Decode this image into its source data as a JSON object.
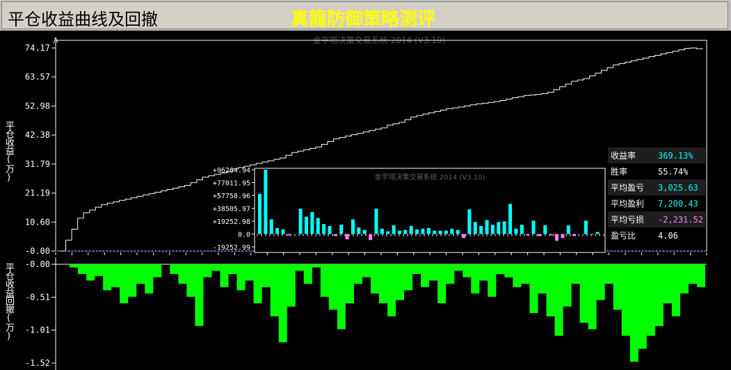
{
  "title_left": "平仓收益曲线及回撤",
  "title_center": "真龍防御策略测评",
  "watermark_main": "金字塔决策交易系统 2014 (V3.10)",
  "watermark_inset": "金字塔决策交易系统 2014 (V3.10)",
  "colors": {
    "bg": "#000000",
    "equity_line": "#ffffff",
    "drawdown_fill": "#00ff00",
    "bar_pos": "#00ffff",
    "bar_neg": "#ff80ff",
    "zero_line": "#4040ff",
    "title_text": "#ffff00"
  },
  "stats": [
    {
      "label": "收益率",
      "value": "369.13%",
      "color": "#00ffff",
      "shaded": true
    },
    {
      "label": "胜率",
      "value": "55.74%",
      "color": "#ffffff",
      "shaded": false
    },
    {
      "label": "平均盈亏",
      "value": "3,025.63",
      "color": "#00ffff",
      "shaded": true
    },
    {
      "label": "平均盈利",
      "value": "7,200.43",
      "color": "#00ffff",
      "shaded": false
    },
    {
      "label": "平均亏损",
      "value": "-2,231.52",
      "color": "#ff80ff",
      "shaded": true
    },
    {
      "label": "盈亏比",
      "value": "4.06",
      "color": "#ffffff",
      "shaded": false
    }
  ],
  "chart_data": [
    {
      "type": "line",
      "ylabel": "平仓收益(万)",
      "yticks": [
        "74.17",
        "63.57",
        "52.98",
        "42.38",
        "31.79",
        "21.19",
        "10.60",
        "-0.00"
      ],
      "ylim": [
        0,
        74.17
      ],
      "series": [
        {
          "values": [
            0,
            4,
            8,
            12,
            14,
            15,
            16,
            17,
            17.5,
            18,
            18.5,
            19,
            19.5,
            20,
            20.5,
            21,
            21.5,
            22,
            22.5,
            23,
            23.5,
            24,
            25,
            26,
            27,
            27.5,
            28,
            28.5,
            29,
            30,
            30.5,
            31,
            31.5,
            32,
            32.5,
            33,
            33.5,
            34,
            35,
            36,
            36.5,
            37,
            37.5,
            38,
            39,
            40,
            41,
            41.5,
            42,
            42.5,
            43,
            43.5,
            44,
            44.5,
            45,
            46,
            46.5,
            47,
            48,
            49,
            49.5,
            50,
            50.5,
            51,
            51.5,
            52,
            52.3,
            52.6,
            53,
            53.4,
            53.8,
            54,
            54.3,
            54.6,
            55,
            55.5,
            56,
            56.4,
            56.8,
            57,
            57.2,
            57.5,
            58,
            59,
            60,
            61,
            62,
            62.5,
            63,
            64,
            65,
            66,
            67,
            68,
            68.5,
            69,
            69.5,
            70,
            70.5,
            71,
            71.5,
            72,
            72.5,
            73,
            73.5,
            74,
            74.17,
            73.9,
            74.1
          ]
        }
      ]
    },
    {
      "type": "bar",
      "title": "金字塔决策交易系统 2014 (V3.10)",
      "yticks": [
        "+96264.94",
        "+77011.95",
        "+57758.96",
        "+38505.97",
        "+19252.98",
        "0.0",
        "-19252.99"
      ],
      "ylim": [
        -19252.99,
        96264.94
      ],
      "values": [
        60000,
        96264,
        22000,
        9000,
        7000,
        -2000,
        0,
        38000,
        26000,
        33000,
        24000,
        15000,
        12000,
        -3000,
        14000,
        -8000,
        22000,
        10000,
        6000,
        -9000,
        38000,
        8000,
        4000,
        13000,
        5000,
        6000,
        12000,
        7000,
        8000,
        9000,
        5000,
        5000,
        5000,
        8000,
        6000,
        -6000,
        37000,
        18000,
        12000,
        21000,
        14000,
        18000,
        19000,
        45000,
        8000,
        14000,
        -2000,
        20000,
        -3000,
        13000,
        -2000,
        -10000,
        -6000,
        13000,
        -3000,
        0,
        20000,
        -1000,
        3000
      ]
    },
    {
      "type": "area",
      "ylabel": "平仓收益回撤(万)",
      "yticks": [
        "-0.00",
        "-0.51",
        "-1.01",
        "-1.52"
      ],
      "ylim": [
        -1.52,
        0
      ],
      "values": [
        0,
        -0.05,
        -0.15,
        -0.25,
        -0.18,
        -0.4,
        -0.35,
        -0.6,
        -0.5,
        -0.3,
        -0.45,
        -0.2,
        0,
        -0.15,
        -0.3,
        -0.5,
        -0.95,
        -0.2,
        -0.1,
        -0.35,
        -0.15,
        -0.4,
        -0.25,
        -0.6,
        -0.35,
        -0.8,
        -1.2,
        -0.65,
        -0.1,
        -0.3,
        -0.05,
        -0.5,
        -0.7,
        -1.0,
        -0.6,
        -0.3,
        -0.2,
        -0.45,
        -0.6,
        -0.8,
        -0.55,
        -0.4,
        -0.15,
        -0.35,
        -0.25,
        -0.6,
        -0.3,
        -0.1,
        -0.2,
        -0.45,
        -0.25,
        -0.5,
        -0.15,
        -0.2,
        -0.35,
        -0.3,
        -0.75,
        -0.45,
        -0.8,
        -1.1,
        -0.65,
        -0.3,
        -0.9,
        -1.0,
        -0.55,
        -0.3,
        -0.7,
        -1.1,
        -1.5,
        -1.3,
        -1.1,
        -0.95,
        -0.6,
        -0.8,
        -0.45,
        -0.3,
        -0.35
      ]
    }
  ]
}
